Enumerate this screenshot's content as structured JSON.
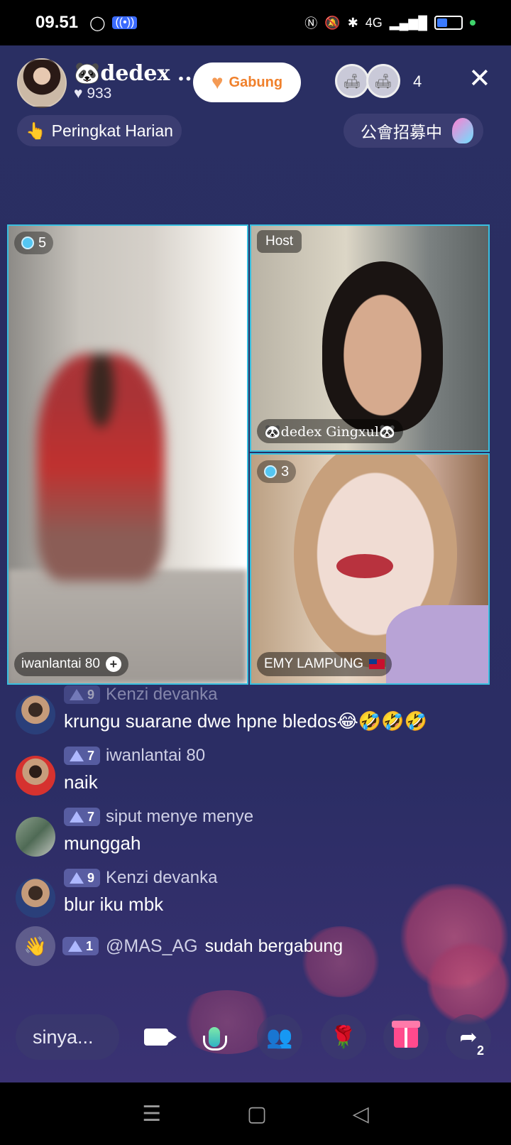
{
  "status": {
    "time": "09.51",
    "network": "4G",
    "battery_level": 0.4
  },
  "header": {
    "host_name": "🐼dedex ...",
    "likes": "933",
    "join_label": "Gabung",
    "viewer_count": "4",
    "rank_label": "Peringkat Harian",
    "guild_label": "公會招募中"
  },
  "tiles": [
    {
      "badge": "5",
      "name": "iwanlantai 80"
    },
    {
      "host_tag": "Host",
      "name": "🐼dedex Gingxul🐼"
    },
    {
      "badge": "3",
      "name": "EMY LAMPUNG"
    }
  ],
  "chat": {
    "messages": [
      {
        "level": "9",
        "user": "Kenzi devanka",
        "text": "krungu suarane dwe hpne bledos😂🤣🤣🤣"
      },
      {
        "level": "7",
        "user": "iwanlantai 80",
        "text": "naik"
      },
      {
        "level": "7",
        "user": "siput menye menye",
        "text": "munggah"
      },
      {
        "level": "9",
        "user": "Kenzi devanka",
        "text": "blur iku mbk"
      }
    ],
    "join": {
      "level": "1",
      "handle": "@MAS_AG",
      "text": "sudah bergabung"
    }
  },
  "toolbar": {
    "input_placeholder": "sinya...",
    "share_count": "2"
  },
  "colors": {
    "accent": "#f0802b",
    "tile_border": "#38bfe0",
    "gift": "#ff4a8d",
    "background": "#2a2f63"
  }
}
